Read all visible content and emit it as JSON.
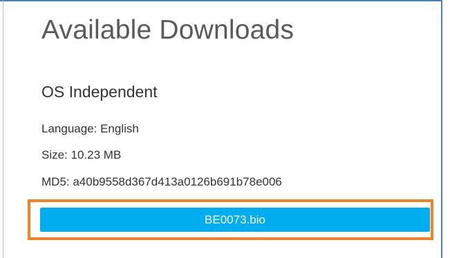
{
  "section": {
    "title": "Available Downloads",
    "os_heading": "OS Independent"
  },
  "file": {
    "language_line": "Language: English",
    "size_line": "Size: 10.23 MB",
    "md5_line": "MD5: a40b9558d367d413a0126b691b78e006",
    "download_label": "BE0073.bio"
  },
  "colors": {
    "button": "#00aeef",
    "highlight_border": "#f58220",
    "frame_border": "#4a7ebb"
  }
}
